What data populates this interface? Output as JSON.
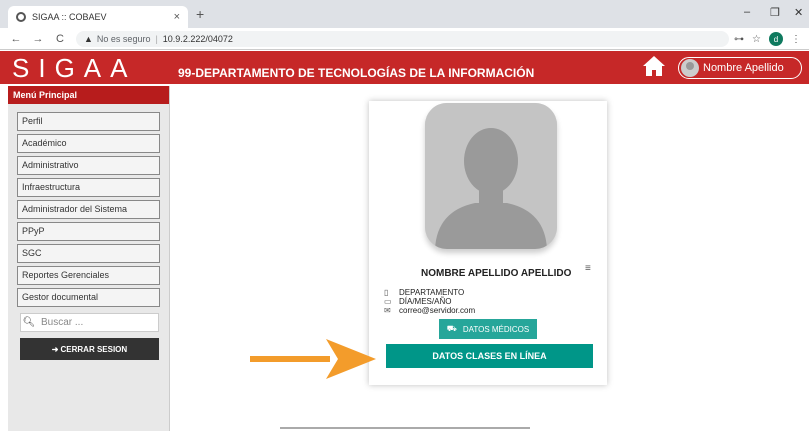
{
  "browser": {
    "tab_title": "SIGAA :: COBAEV",
    "tab_close": "×",
    "new_tab": "+",
    "not_secure": "No es seguro",
    "url": "10.9.2.222/04072",
    "profile_initial": "d"
  },
  "header": {
    "logo": "SIGAA",
    "title": "99-DEPARTAMENTO DE TECNOLOGÍAS DE LA INFORMACIÓN",
    "user_name": "Nombre Apellido"
  },
  "sidebar": {
    "heading": "Menú Principal",
    "items": [
      {
        "label": "Perfil"
      },
      {
        "label": "Académico"
      },
      {
        "label": "Administrativo"
      },
      {
        "label": "Infraestructura"
      },
      {
        "label": "Administrador del Sistema"
      },
      {
        "label": "PPyP"
      },
      {
        "label": "SGC"
      },
      {
        "label": "Reportes Gerenciales"
      },
      {
        "label": "Gestor documental"
      }
    ],
    "search_placeholder": "Buscar ...",
    "logout_label": "CERRAR SESION"
  },
  "profile": {
    "name": "NOMBRE APELLIDO APELLIDO",
    "department": "DEPARTAMENTO",
    "date": "DÍA/MES/AÑO",
    "email": "correo@servidor.com",
    "medical_button": "DATOS MÉDICOS",
    "classes_button": "DATOS CLASES EN LÍNEA"
  },
  "colors": {
    "header_red": "#c62828",
    "teal": "#009688",
    "arrow_orange": "#f39c2b"
  }
}
